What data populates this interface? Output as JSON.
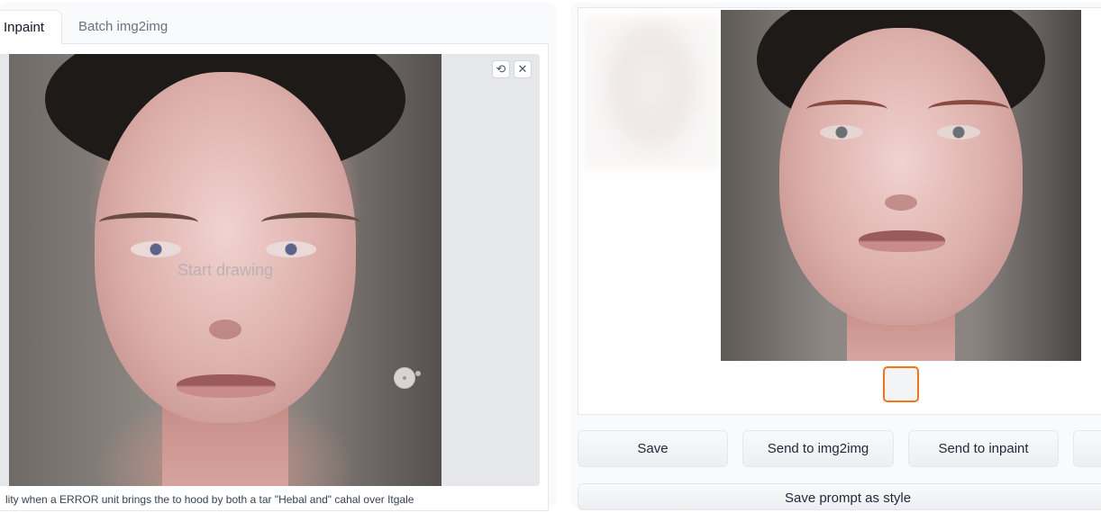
{
  "tabs": [
    {
      "label": "Inpaint",
      "active": true
    },
    {
      "label": "Batch img2img",
      "active": false
    }
  ],
  "inpaint_canvas": {
    "placeholder": "Start drawing",
    "undo_icon": "undo-icon",
    "clear_icon": "close-icon",
    "undo_glyph": "⟲",
    "clear_glyph": "✕"
  },
  "bottom_text": "lity when a ERROR unit brings the to hood by both a tar \"Hebal and\" cahal over Itgale",
  "output": {
    "buttons": {
      "save": "Save",
      "send_img2img": "Send to img2img",
      "send_inpaint": "Send to inpaint",
      "extra": ""
    },
    "save_prompt_style": "Save prompt as style"
  },
  "colors": {
    "selected_thumb_border": "#f97316",
    "panel_bg": "#f9fafb"
  }
}
